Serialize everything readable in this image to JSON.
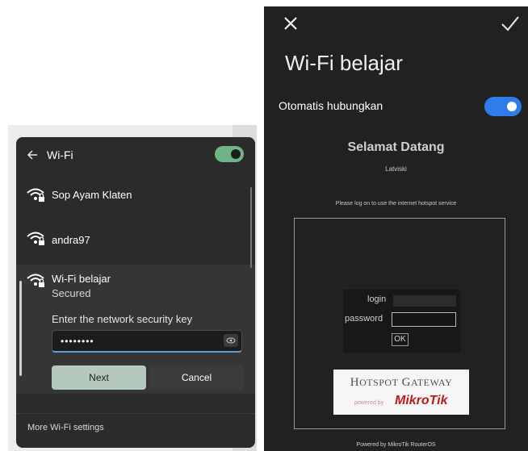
{
  "wifi_flyout": {
    "title": "Wi-Fi",
    "wifi_enabled": true,
    "networks": [
      {
        "name": "Sop Ayam Klaten",
        "icon": "wifi-locked-icon"
      },
      {
        "name": "andra97",
        "icon": "wifi-locked-icon"
      }
    ],
    "selected_network": {
      "name": "Wi-Fi belajar",
      "status": "Secured",
      "key_prompt": "Enter the network security key",
      "key_value": "••••••••",
      "next_label": "Next",
      "cancel_label": "Cancel"
    },
    "more_settings": "More Wi-Fi settings"
  },
  "phone": {
    "ssid": "Wi-Fi belajar",
    "auto_connect_label": "Otomatis hubungkan",
    "auto_connect_enabled": true,
    "welcome": "Selamat Datang",
    "location": "Latviski",
    "notice": "Please log on to use the internet hotspot service",
    "form": {
      "login_label": "login",
      "password_label": "password",
      "ok_label": "OK"
    },
    "hotspot_logo": {
      "title": "Hotspot Gateway",
      "powered_by": "powered by",
      "brand": "MikroTik"
    },
    "footer": "Powered by MikroTik RouterOS"
  },
  "colors": {
    "flyout_bg": "#2b2b2b",
    "windows_accent": "#6fb386",
    "android_accent": "#2f7dea",
    "mikrotik_red": "#b71d1d"
  }
}
